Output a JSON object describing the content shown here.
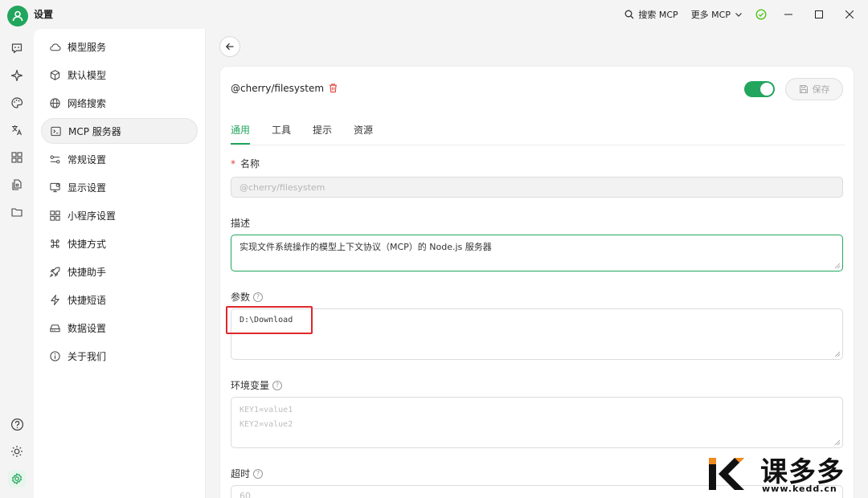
{
  "titlebar": {
    "title": "设置",
    "search_mcp": "搜索 MCP",
    "more_mcp": "更多 MCP"
  },
  "menu": {
    "items": [
      {
        "label": "模型服务",
        "icon": "cloud-icon"
      },
      {
        "label": "默认模型",
        "icon": "cube-icon"
      },
      {
        "label": "网络搜索",
        "icon": "globe-icon"
      },
      {
        "label": "MCP 服务器",
        "icon": "terminal-icon"
      },
      {
        "label": "常规设置",
        "icon": "sliders-icon"
      },
      {
        "label": "显示设置",
        "icon": "monitor-icon"
      },
      {
        "label": "小程序设置",
        "icon": "grid-icon"
      },
      {
        "label": "快捷方式",
        "icon": "command-icon"
      },
      {
        "label": "快捷助手",
        "icon": "rocket-icon"
      },
      {
        "label": "快捷短语",
        "icon": "zap-icon"
      },
      {
        "label": "数据设置",
        "icon": "hard-drive-icon"
      },
      {
        "label": "关于我们",
        "icon": "info-icon"
      }
    ]
  },
  "server": {
    "name": "@cherry/filesystem",
    "enabled": true,
    "save_label": "保存"
  },
  "tabs": [
    "通用",
    "工具",
    "提示",
    "资源"
  ],
  "form": {
    "name_label": "名称",
    "name_value": "@cherry/filesystem",
    "desc_label": "描述",
    "desc_value": "实现文件系统操作的模型上下文协议（MCP）的 Node.js 服务器",
    "args_label": "参数",
    "args_value": "D:\\Download",
    "env_label": "环境变量",
    "env_placeholder_1": "KEY1=value1",
    "env_placeholder_2": "KEY2=value2",
    "timeout_label": "超时",
    "timeout_value": "60"
  },
  "watermark": {
    "brand": "课多多",
    "url": "www.kedd.cn"
  },
  "colors": {
    "accent": "#22a65e",
    "danger": "#e0443c",
    "highlight": "#e0272a"
  }
}
